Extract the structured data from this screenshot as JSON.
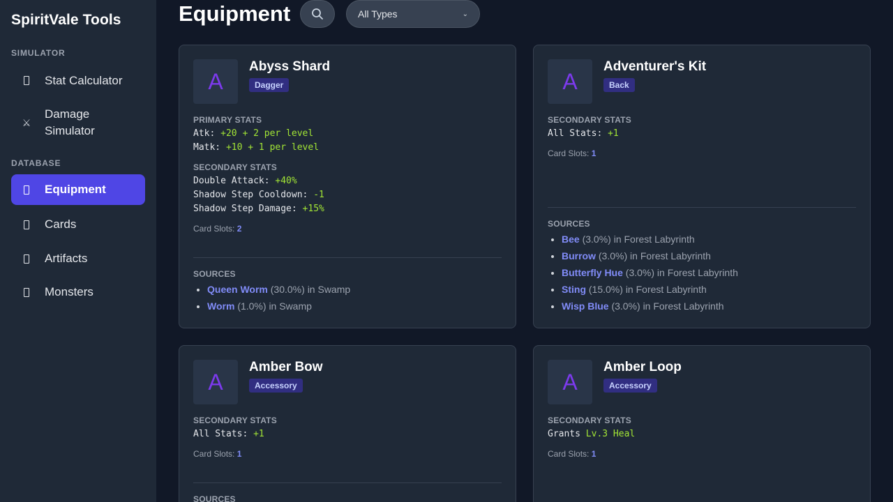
{
  "app": {
    "title": "SpiritVale Tools"
  },
  "sidebar": {
    "sections": [
      {
        "label": "SIMULATOR"
      },
      {
        "label": "DATABASE"
      }
    ],
    "items": [
      {
        "label": "Stat Calculator",
        "icon": "calculator-icon"
      },
      {
        "label": "Damage Simulator",
        "icon": "swords-icon"
      },
      {
        "label": "Equipment",
        "icon": "equipment-icon",
        "active": true
      },
      {
        "label": "Cards",
        "icon": "cards-icon"
      },
      {
        "label": "Artifacts",
        "icon": "artifacts-icon"
      },
      {
        "label": "Monsters",
        "icon": "monsters-icon"
      }
    ]
  },
  "header": {
    "title": "Equipment",
    "search_icon": "search-icon",
    "type_filter": {
      "value": "All Types"
    }
  },
  "labels": {
    "primary": "PRIMARY STATS",
    "secondary": "SECONDARY STATS",
    "card_slots": "Card Slots:",
    "sources": "SOURCES",
    "in": "in"
  },
  "colors": {
    "accent": "#4f46e5",
    "link": "#818cf8",
    "value": "#a3e635",
    "avatar_letter": "#7c3aed"
  },
  "items": [
    {
      "letter": "A",
      "name": "Abyss Shard",
      "type": "Dagger",
      "primary": [
        {
          "name": "Atk:",
          "value": "+20 + 2 per level"
        },
        {
          "name": "Matk:",
          "value": "+10 + 1 per level"
        }
      ],
      "secondary": [
        {
          "name": "Double Attack:",
          "value": "+40%"
        },
        {
          "name": "Shadow Step Cooldown:",
          "value": "-1"
        },
        {
          "name": "Shadow Step Damage:",
          "value": "+15%"
        }
      ],
      "card_slots": "2",
      "sources": [
        {
          "monster": "Queen Worm",
          "rate": "(30.0%)",
          "location": "Swamp"
        },
        {
          "monster": "Worm",
          "rate": "(1.0%)",
          "location": "Swamp"
        }
      ]
    },
    {
      "letter": "A",
      "name": "Adventurer's Kit",
      "type": "Back",
      "secondary": [
        {
          "name": "All Stats:",
          "value": "+1"
        }
      ],
      "card_slots": "1",
      "sources": [
        {
          "monster": "Bee",
          "rate": "(3.0%)",
          "location": "Forest Labyrinth"
        },
        {
          "monster": "Burrow",
          "rate": "(3.0%)",
          "location": "Forest Labyrinth"
        },
        {
          "monster": "Butterfly Hue",
          "rate": "(3.0%)",
          "location": "Forest Labyrinth"
        },
        {
          "monster": "Sting",
          "rate": "(15.0%)",
          "location": "Forest Labyrinth"
        },
        {
          "monster": "Wisp Blue",
          "rate": "(3.0%)",
          "location": "Forest Labyrinth"
        }
      ]
    },
    {
      "letter": "A",
      "name": "Amber Bow",
      "type": "Accessory",
      "secondary": [
        {
          "name": "All Stats:",
          "value": "+1"
        }
      ],
      "card_slots": "1"
    },
    {
      "letter": "A",
      "name": "Amber Loop",
      "type": "Accessory",
      "secondary": [
        {
          "name": "Grants",
          "value": "Lv.3 Heal"
        }
      ],
      "card_slots": "1"
    }
  ]
}
